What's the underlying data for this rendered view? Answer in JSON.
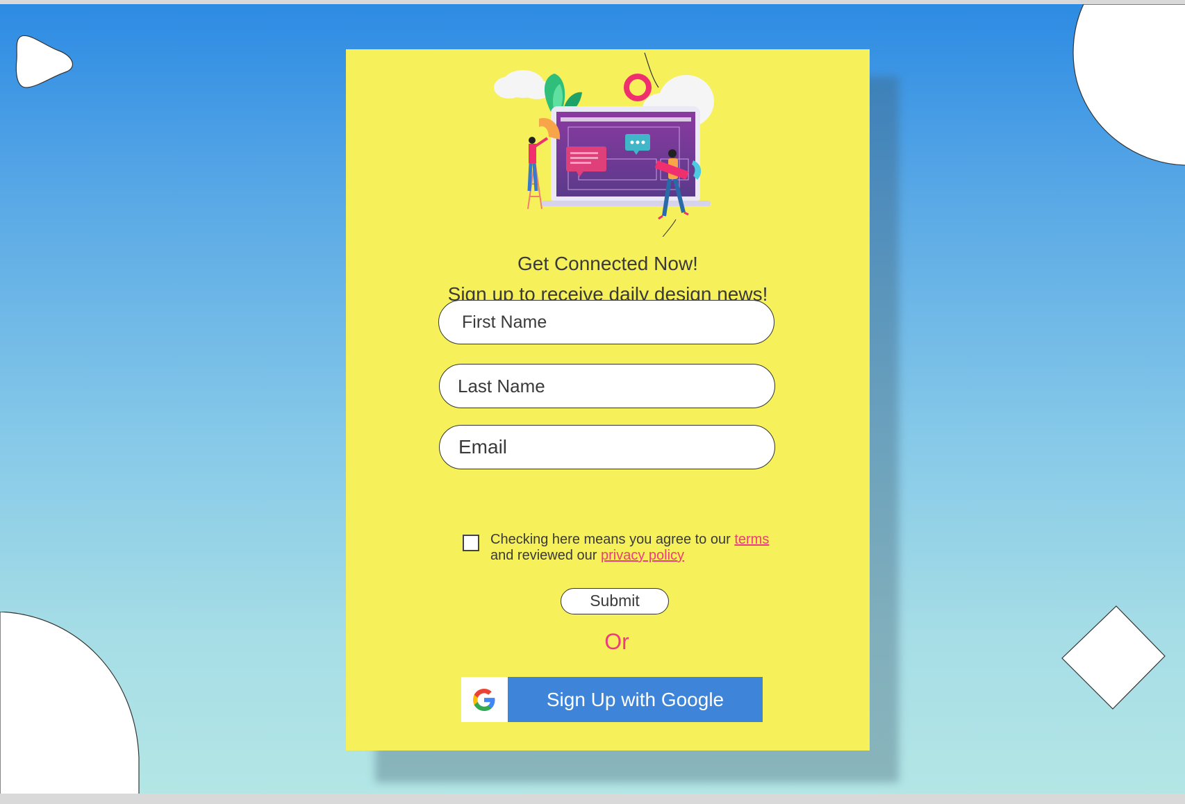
{
  "form": {
    "title": "Get Connected Now!",
    "subtitle": "Sign up to receive daily design news!",
    "first_name_placeholder": "First Name",
    "last_name_placeholder": "Last Name",
    "email_placeholder": "Email",
    "agree_text_1": "Checking here means you agree to our ",
    "terms_link": "terms",
    "agree_text_2": "and reviewed our ",
    "privacy_link": "privacy policy",
    "submit_label": "Submit",
    "or_label": "Or",
    "google_label": "Sign Up with Google"
  },
  "colors": {
    "background_top": "#2d8be3",
    "background_bottom": "#b3e6e5",
    "card": "#f6f05a",
    "accent_pink": "#ec3d7a",
    "google_blue": "#3e84d8"
  }
}
